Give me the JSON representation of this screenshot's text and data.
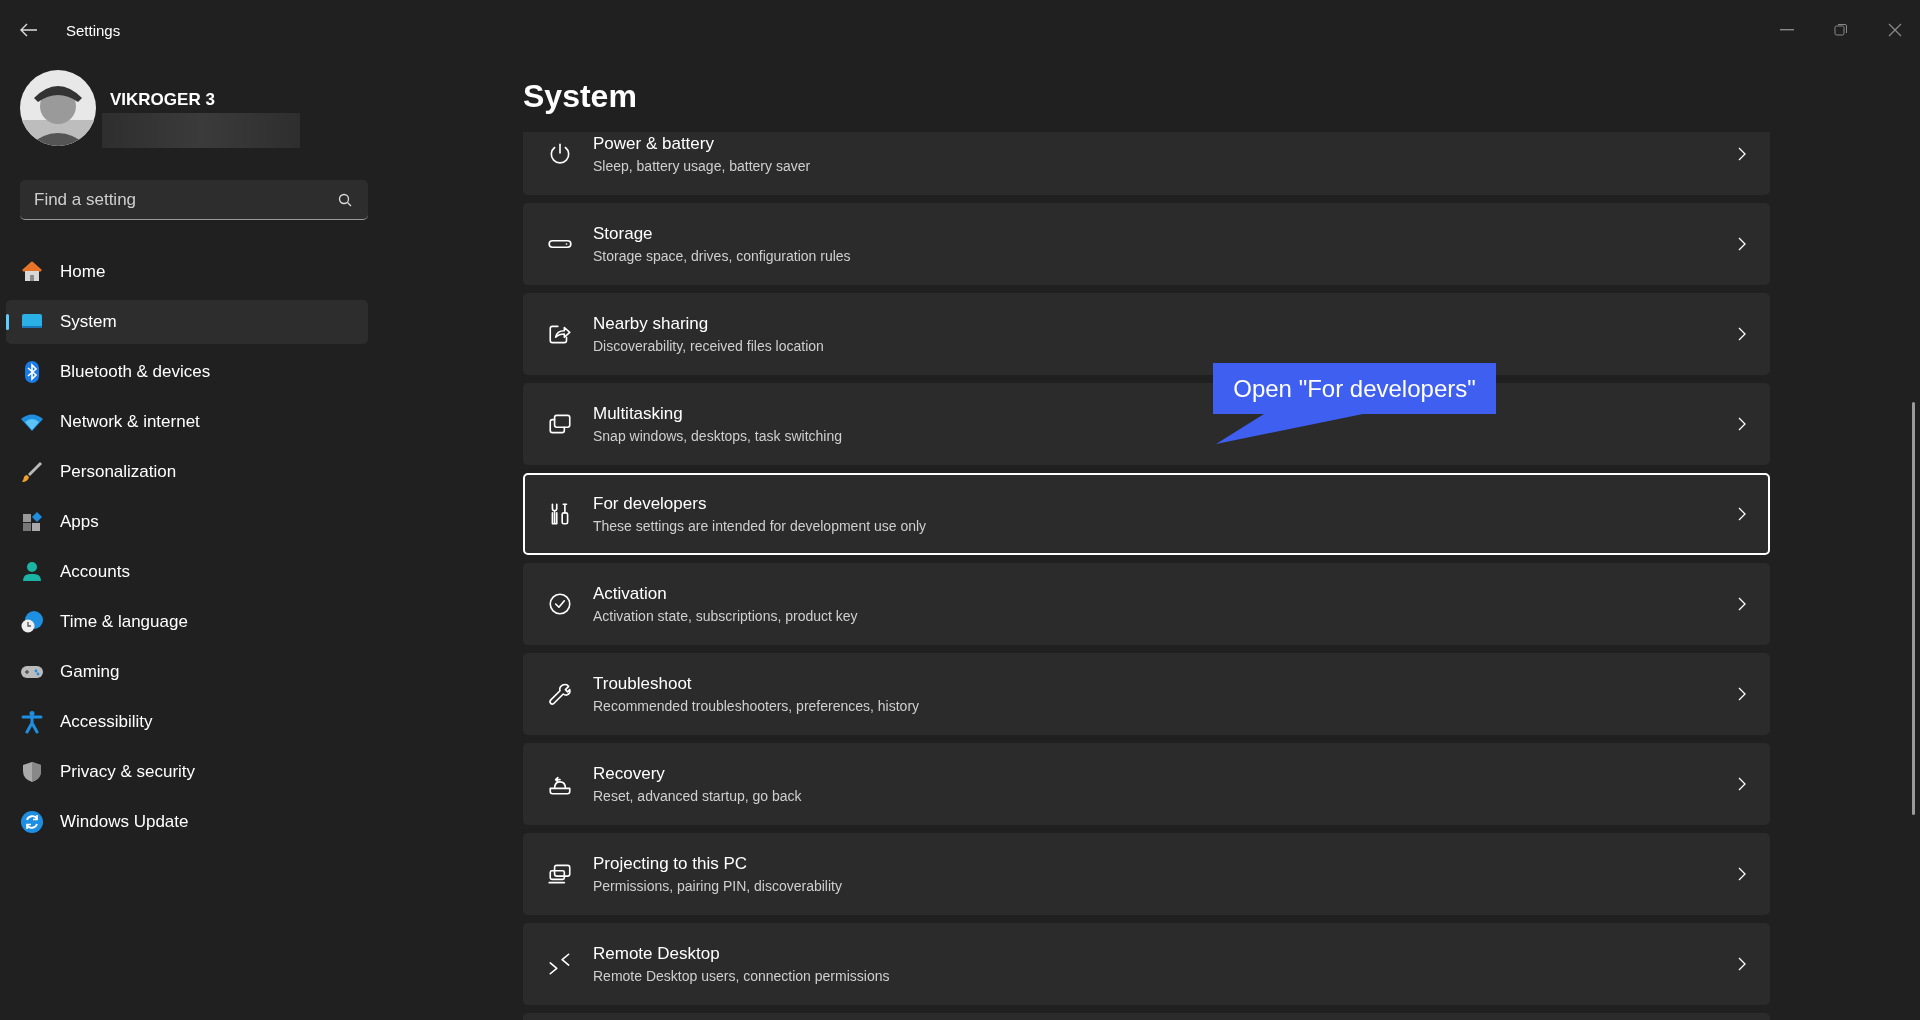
{
  "window": {
    "title": "Settings"
  },
  "sidebar": {
    "user": {
      "name": "VIKROGER 3"
    },
    "search": {
      "placeholder": "Find a setting"
    },
    "items": [
      {
        "label": "Home",
        "selected": false
      },
      {
        "label": "System",
        "selected": true
      },
      {
        "label": "Bluetooth & devices",
        "selected": false
      },
      {
        "label": "Network & internet",
        "selected": false
      },
      {
        "label": "Personalization",
        "selected": false
      },
      {
        "label": "Apps",
        "selected": false
      },
      {
        "label": "Accounts",
        "selected": false
      },
      {
        "label": "Time & language",
        "selected": false
      },
      {
        "label": "Gaming",
        "selected": false
      },
      {
        "label": "Accessibility",
        "selected": false
      },
      {
        "label": "Privacy & security",
        "selected": false
      },
      {
        "label": "Windows Update",
        "selected": false
      }
    ]
  },
  "page": {
    "title": "System",
    "rows": [
      {
        "title": "Power & battery",
        "subtitle": "Sleep, battery usage, battery saver",
        "focused": false
      },
      {
        "title": "Storage",
        "subtitle": "Storage space, drives, configuration rules",
        "focused": false
      },
      {
        "title": "Nearby sharing",
        "subtitle": "Discoverability, received files location",
        "focused": false
      },
      {
        "title": "Multitasking",
        "subtitle": "Snap windows, desktops, task switching",
        "focused": false
      },
      {
        "title": "For developers",
        "subtitle": "These settings are intended for development use only",
        "focused": true
      },
      {
        "title": "Activation",
        "subtitle": "Activation state, subscriptions, product key",
        "focused": false
      },
      {
        "title": "Troubleshoot",
        "subtitle": "Recommended troubleshooters, preferences, history",
        "focused": false
      },
      {
        "title": "Recovery",
        "subtitle": "Reset, advanced startup, go back",
        "focused": false
      },
      {
        "title": "Projecting to this PC",
        "subtitle": "Permissions, pairing PIN, discoverability",
        "focused": false
      },
      {
        "title": "Remote Desktop",
        "subtitle": "Remote Desktop users, connection permissions",
        "focused": false
      }
    ]
  },
  "callout": {
    "text": "Open \"For developers\""
  }
}
